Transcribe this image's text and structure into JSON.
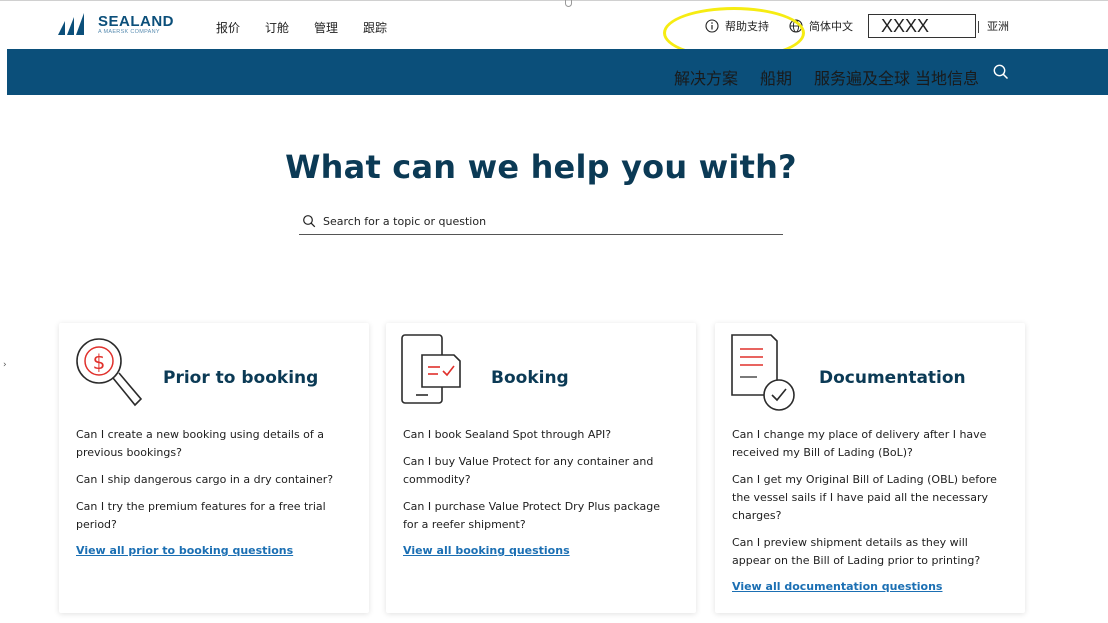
{
  "brand": {
    "name": "SEALAND",
    "tagline": "A MAERSK COMPANY"
  },
  "top_nav": [
    "报价",
    "订舱",
    "管理",
    "跟踪"
  ],
  "utility": {
    "help_label": "帮助支持",
    "language_label": "简体中文",
    "redacted_box": "XXXX",
    "region_label": "亚洲"
  },
  "blue_nav": [
    "解决方案",
    "船期",
    "服务遍及全球",
    "当地信息"
  ],
  "hero": {
    "title": "What can we help you with?",
    "search_placeholder": "Search for a topic or question"
  },
  "cards": [
    {
      "title": "Prior to booking",
      "icon": "dollar-magnifier-icon",
      "questions": [
        "Can I create a new booking using details of a previous bookings?",
        "Can I ship dangerous cargo in a dry container?",
        "Can I try the premium features for a free trial period?"
      ],
      "link": "View all prior to booking questions"
    },
    {
      "title": "Booking",
      "icon": "tablet-check-icon",
      "questions": [
        "Can I book Sealand Spot through API?",
        "Can I buy Value Protect for any container and commodity?",
        "Can I purchase Value Protect Dry Plus package for a reefer shipment?"
      ],
      "link": "View all booking questions"
    },
    {
      "title": "Documentation",
      "icon": "document-check-icon",
      "questions": [
        "Can I change my place of delivery after I have received my Bill of Lading (BoL)?",
        "Can I get my Original Bill of Lading (OBL) before the vessel sails if I have paid all the necessary charges?",
        "Can I preview shipment details as they will appear on the Bill of Lading prior to printing?"
      ],
      "link": "View all documentation questions"
    }
  ],
  "colors": {
    "brand_blue": "#0b4f7a",
    "title_navy": "#0b3a55",
    "link_blue": "#1b6fb3",
    "icon_red": "#e0302b",
    "annotation_yellow": "#f6ec12"
  }
}
